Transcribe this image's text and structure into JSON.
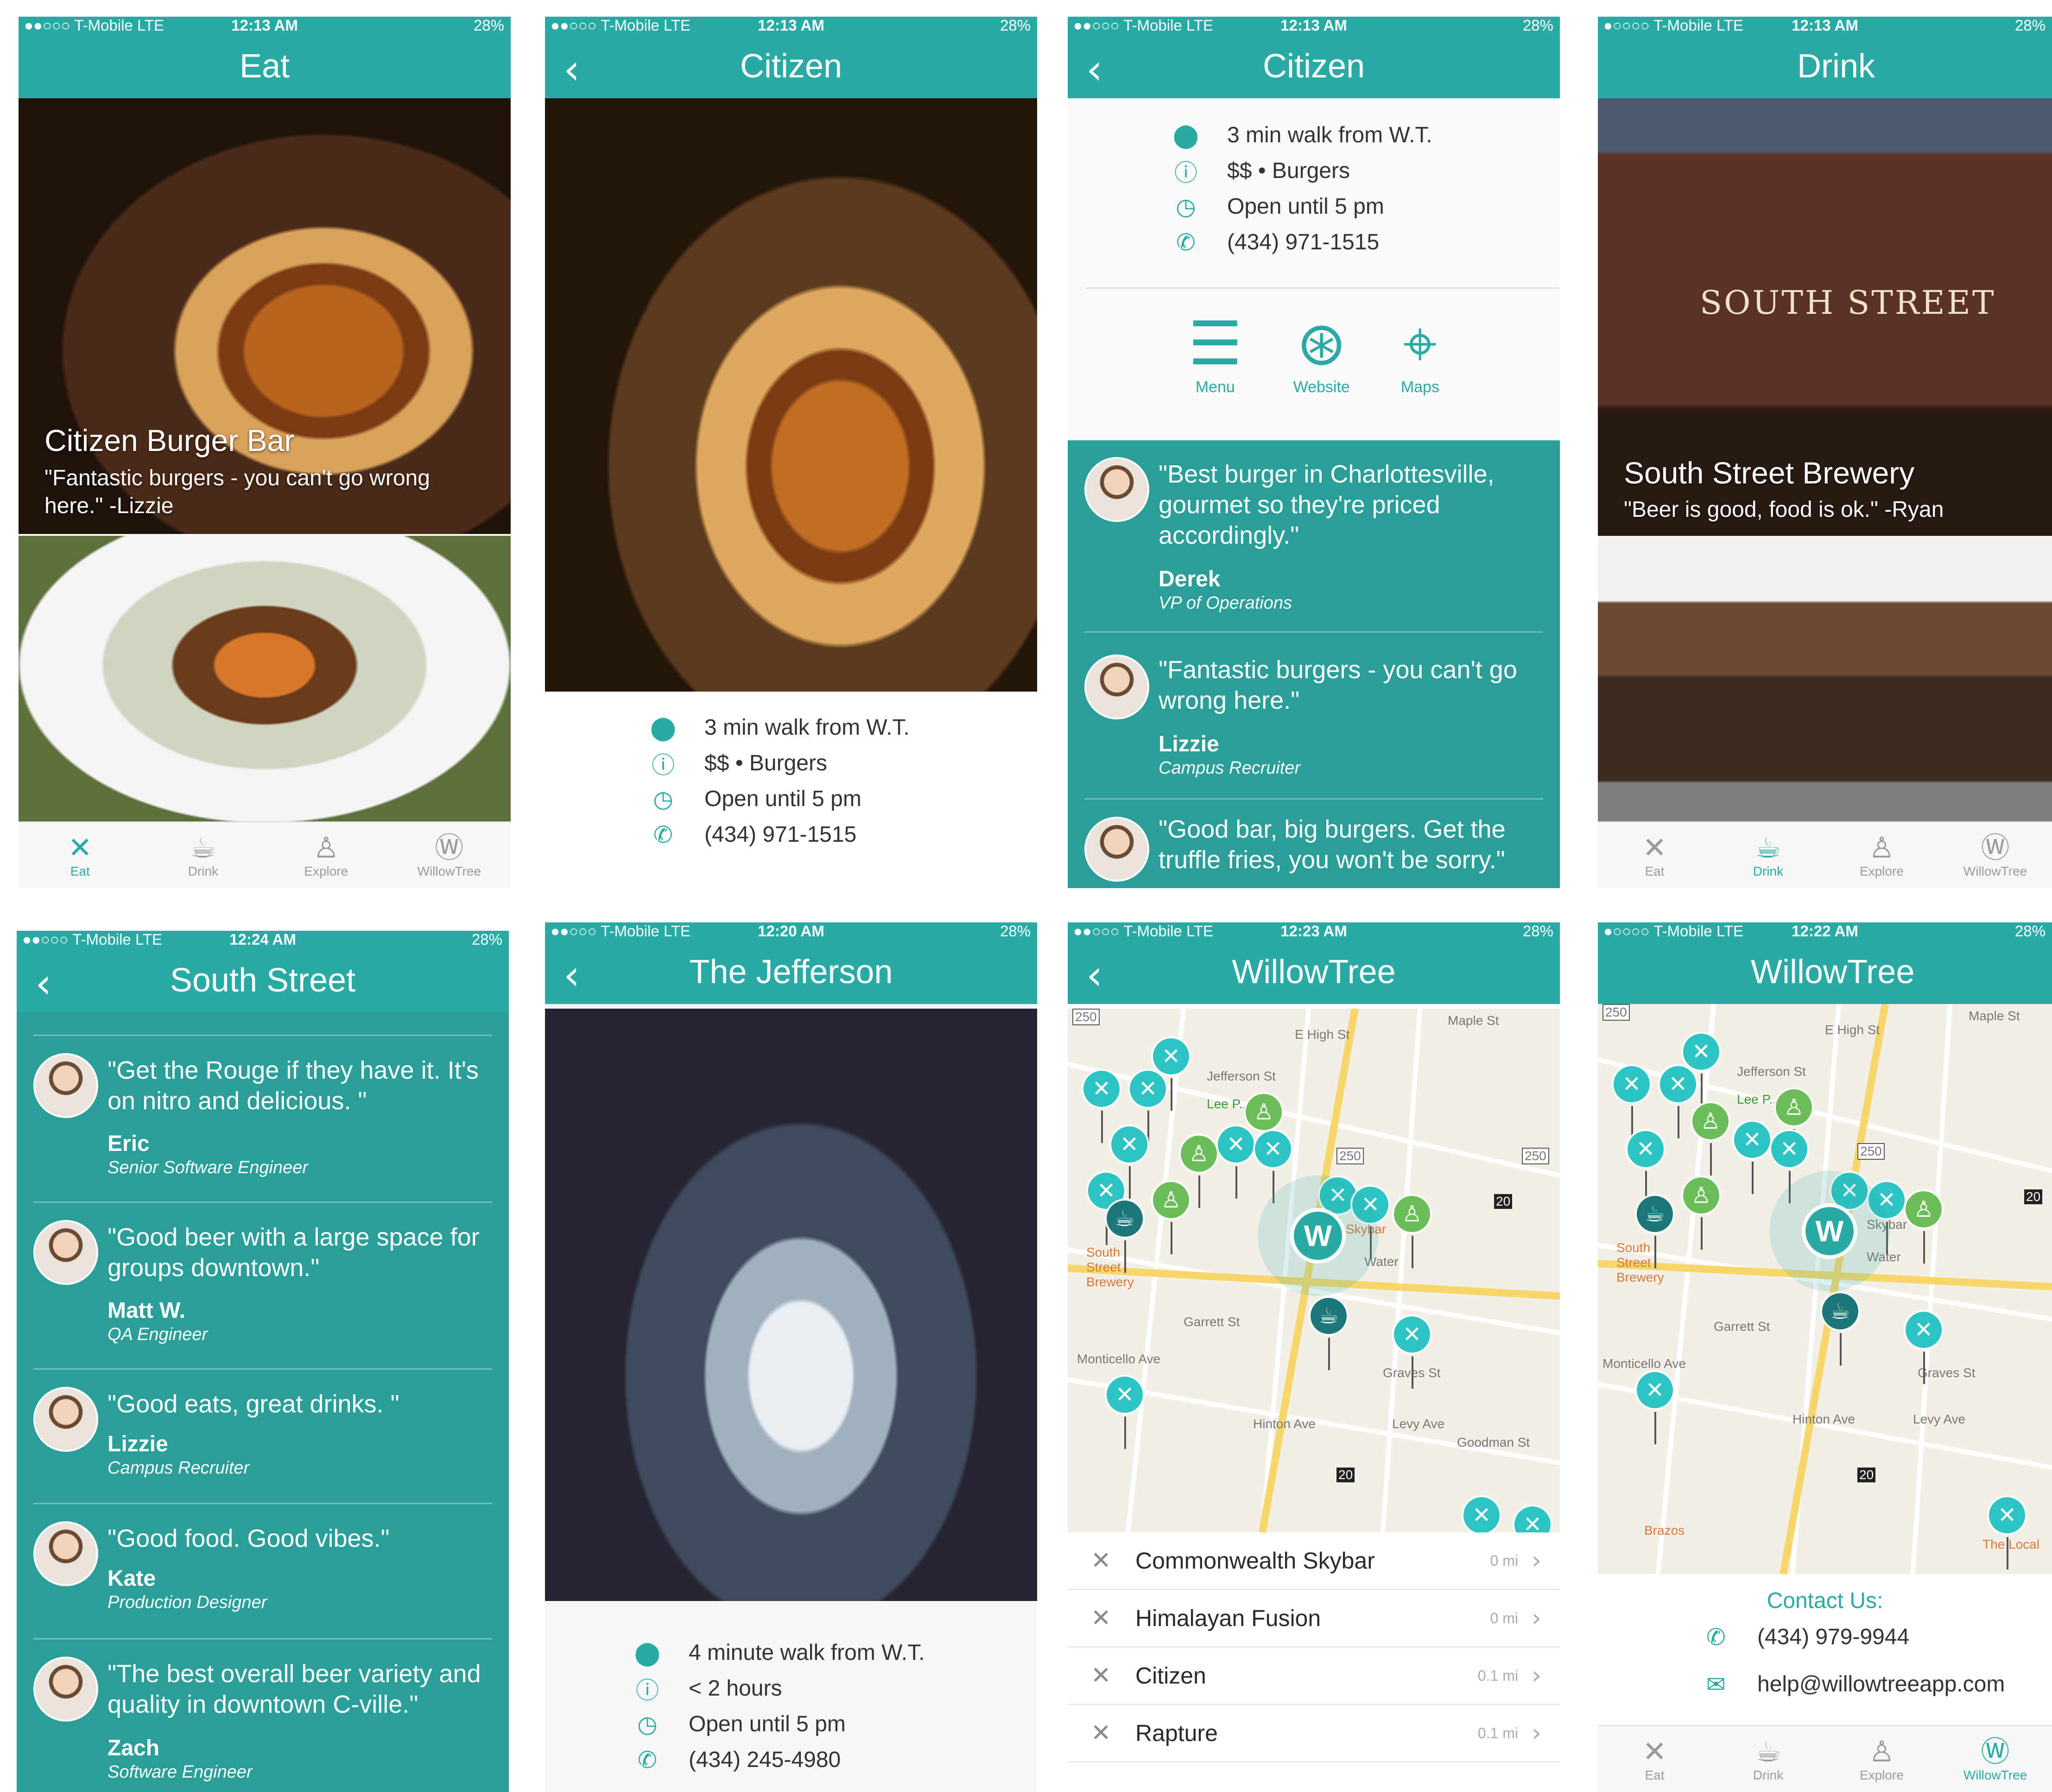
{
  "colors": {
    "brand": "#2aaaa4",
    "brand_dark": "#1b7779",
    "pin_green": "#6bbd5a",
    "tab_inactive": "#9a9a9a"
  },
  "icons": {
    "location": "map-pin-icon",
    "info": "info-icon",
    "clock": "clock-icon",
    "phone": "phone-icon",
    "mail": "mail-icon"
  },
  "tabs": [
    "Eat",
    "Drink",
    "Explore",
    "WillowTree"
  ],
  "screens": {
    "eat": {
      "status": {
        "carrier": "●●○○○ T-Mobile  LTE",
        "time": "12:13 AM",
        "battery": "28%"
      },
      "title": "Eat",
      "card_title": "Citizen Burger Bar",
      "card_quote": "\"Fantastic burgers - you can't go wrong here.\"  -Lizzie"
    },
    "citizen_photo": {
      "status": {
        "carrier": "●●○○○ T-Mobile  LTE",
        "time": "12:13 AM",
        "battery": "28%"
      },
      "title": "Citizen",
      "info": [
        "3 min walk from W.T.",
        "$$ • Burgers",
        "Open until 5 pm",
        "(434) 971-1515"
      ]
    },
    "citizen_details": {
      "status": {
        "carrier": "●●○○○ T-Mobile  LTE",
        "time": "12:13 AM",
        "battery": "28%"
      },
      "title": "Citizen",
      "info": [
        "3 min walk from W.T.",
        "$$ • Burgers",
        "Open until 5 pm",
        "(434) 971-1515"
      ],
      "actions": [
        "Menu",
        "Website",
        "Maps"
      ],
      "reviews": [
        {
          "quote": "\"Best burger in Charlottesville, gourmet so they're priced accordingly.\"",
          "name": "Derek",
          "role": "VP of Operations"
        },
        {
          "quote": "\"Fantastic burgers - you can't go wrong here.\"",
          "name": "Lizzie",
          "role": "Campus Recruiter"
        },
        {
          "quote": "\"Good bar, big burgers. Get the truffle fries, you won't be sorry.\"",
          "name": "",
          "role": ""
        }
      ]
    },
    "drink": {
      "status": {
        "carrier": "●○○○○ T-Mobile  LTE",
        "time": "12:13 AM",
        "battery": "28%"
      },
      "title": "Drink",
      "sign_text": "SOUTH  STREET",
      "card_title": "South Street Brewery",
      "card_quote": "\"Beer is good, food is ok.\"  -Ryan"
    },
    "south_street": {
      "status": {
        "carrier": "●●○○○ T-Mobile  LTE",
        "time": "12:24 AM",
        "battery": "28%"
      },
      "title": "South Street",
      "reviews": [
        {
          "quote": "\"Get the Rouge if they have it. It's on nitro and delicious. \"",
          "name": "Eric",
          "role": "Senior Software Engineer"
        },
        {
          "quote": "\"Good beer with a large space for groups downtown.\"",
          "name": "Matt W.",
          "role": "QA Engineer"
        },
        {
          "quote": "\"Good eats, great drinks. \"",
          "name": "Lizzie",
          "role": "Campus Recruiter"
        },
        {
          "quote": "\"Good food. Good vibes.\"",
          "name": "Kate",
          "role": "Production Designer"
        },
        {
          "quote": "\"The best overall beer variety and quality in downtown C-ville.\"",
          "name": "Zach",
          "role": "Software Engineer"
        }
      ]
    },
    "jefferson": {
      "status": {
        "carrier": "●●○○○ T-Mobile  LTE",
        "time": "12:20 AM",
        "battery": "28%"
      },
      "title": "The Jefferson",
      "info": [
        "4 minute walk from W.T.",
        "< 2 hours",
        "Open until 5 pm",
        "(434) 245-4980"
      ]
    },
    "map_list": {
      "status": {
        "carrier": "●●○○○ T-Mobile  LTE",
        "time": "12:23 AM",
        "battery": "28%"
      },
      "title": "WillowTree",
      "streets": [
        "E High St",
        "Jefferson St",
        "Garrett St",
        "Monticello Ave",
        "Graves St",
        "Hinton Ave",
        "Levy Ave",
        "Goodman St",
        "Maple St",
        "South Street Brewery",
        "Skybar",
        "Water",
        "Lee P..."
      ],
      "route_shields": [
        "250",
        "250",
        "250",
        "20",
        "20"
      ],
      "list": [
        {
          "name": "Commonwealth Skybar",
          "distance": "0 mi"
        },
        {
          "name": "Himalayan Fusion",
          "distance": "0 mi"
        },
        {
          "name": "Citizen",
          "distance": "0.1 mi"
        },
        {
          "name": "Rapture",
          "distance": "0.1 mi"
        }
      ]
    },
    "map_contact": {
      "status": {
        "carrier": "●○○○○ T-Mobile  LTE",
        "time": "12:22 AM",
        "battery": "28%"
      },
      "title": "WillowTree",
      "streets": [
        "E High St",
        "Jefferson St",
        "Garrett St",
        "Monticello Ave",
        "Graves St",
        "Hinton Ave",
        "Levy Ave",
        "Maple St",
        "South Street Brewery",
        "Brazos",
        "The Local",
        "Skybar",
        "Water",
        "Lee P..."
      ],
      "route_shields": [
        "250",
        "250",
        "20",
        "20"
      ],
      "contact_title": "Contact Us:",
      "phone": "(434) 979-9944",
      "email": "help@willowtreeapp.com"
    }
  }
}
